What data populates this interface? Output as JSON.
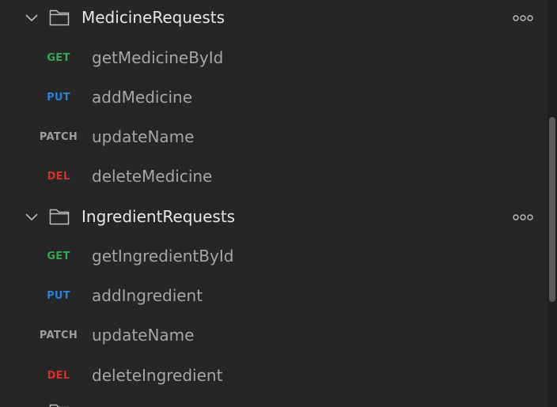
{
  "folders": [
    {
      "name": "MedicineRequests",
      "icon": "folder-icon",
      "requests": [
        {
          "method": "GET",
          "name": "getMedicineById"
        },
        {
          "method": "PUT",
          "name": "addMedicine"
        },
        {
          "method": "PATCH",
          "name": "updateName"
        },
        {
          "method": "DEL",
          "name": "deleteMedicine"
        }
      ]
    },
    {
      "name": "IngredientRequests",
      "icon": "folder-icon",
      "requests": [
        {
          "method": "GET",
          "name": "getIngredientById"
        },
        {
          "method": "PUT",
          "name": "addIngredient"
        },
        {
          "method": "PATCH",
          "name": "updateName"
        },
        {
          "method": "DEL",
          "name": "deleteIngredient"
        }
      ]
    }
  ],
  "colors": {
    "background": "#262626",
    "GET": "#34a853",
    "PUT": "#2d7fd8",
    "PATCH": "#9e9e9e",
    "DEL": "#d93025"
  }
}
